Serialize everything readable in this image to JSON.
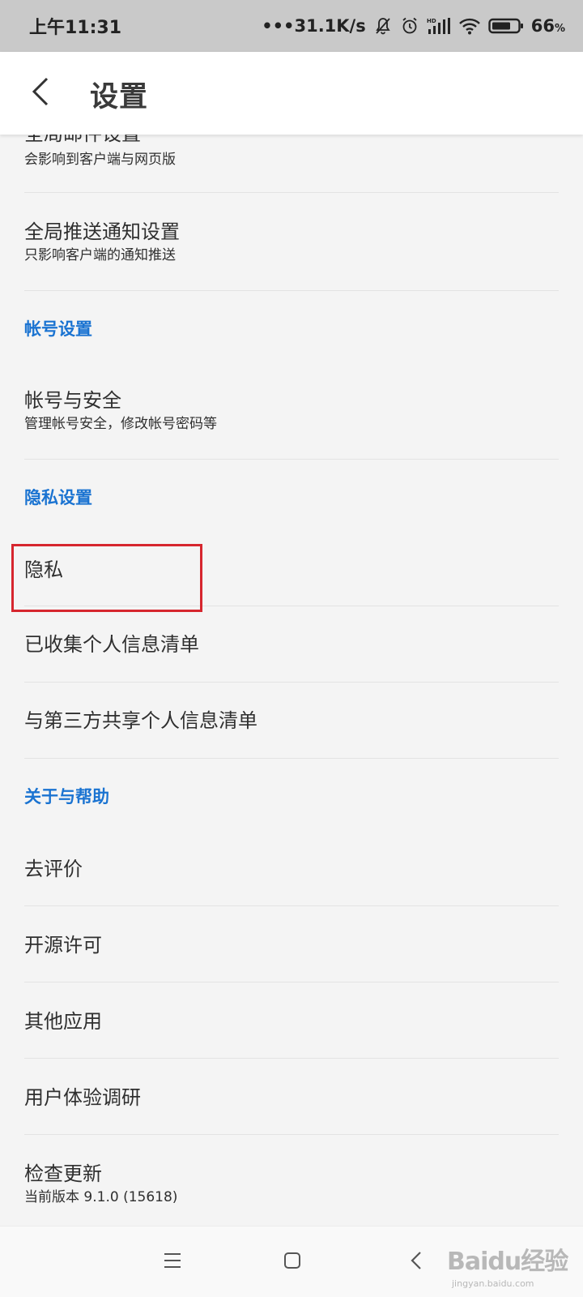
{
  "status_bar": {
    "time": "上午11:31",
    "net_speed": "•••31.1K/s",
    "battery_pct": "66",
    "battery_unit": "%",
    "icons": [
      "mute-bell-icon",
      "alarm-icon",
      "hd-signal-icon",
      "wifi-icon",
      "battery-icon"
    ]
  },
  "header": {
    "title": "设置",
    "back_icon": "chevron-left-icon"
  },
  "list": {
    "global_mail": {
      "title": "全局邮件设置",
      "subtitle": "会影响到客户端与网页版"
    },
    "global_push": {
      "title": "全局推送通知设置",
      "subtitle": "只影响客户端的通知推送"
    },
    "section_account": "帐号设置",
    "account_security": {
      "title": "帐号与安全",
      "subtitle": "管理帐号安全，修改帐号密码等"
    },
    "section_privacy": "隐私设置",
    "privacy": {
      "title": "隐私"
    },
    "collected_info": {
      "title": "已收集个人信息清单"
    },
    "shared_info": {
      "title": "与第三方共享个人信息清单"
    },
    "section_about": "关于与帮助",
    "rate": {
      "title": "去评价"
    },
    "open_source": {
      "title": "开源许可"
    },
    "other_apps": {
      "title": "其他应用"
    },
    "ux_research": {
      "title": "用户体验调研"
    },
    "check_update": {
      "title": "检查更新",
      "subtitle": "当前版本 9.1.0 (15618)"
    }
  },
  "nav_bar": {
    "icons": [
      "menu-icon",
      "home-icon",
      "back-icon"
    ]
  },
  "watermark": {
    "main": "Baidu经验",
    "sub": "jingyan.baidu.com"
  },
  "colors": {
    "section_accent": "#1a73d1",
    "highlight_border": "#d6262e",
    "status_bar_bg": "#c9c9c9",
    "page_bg": "#f4f4f4"
  }
}
